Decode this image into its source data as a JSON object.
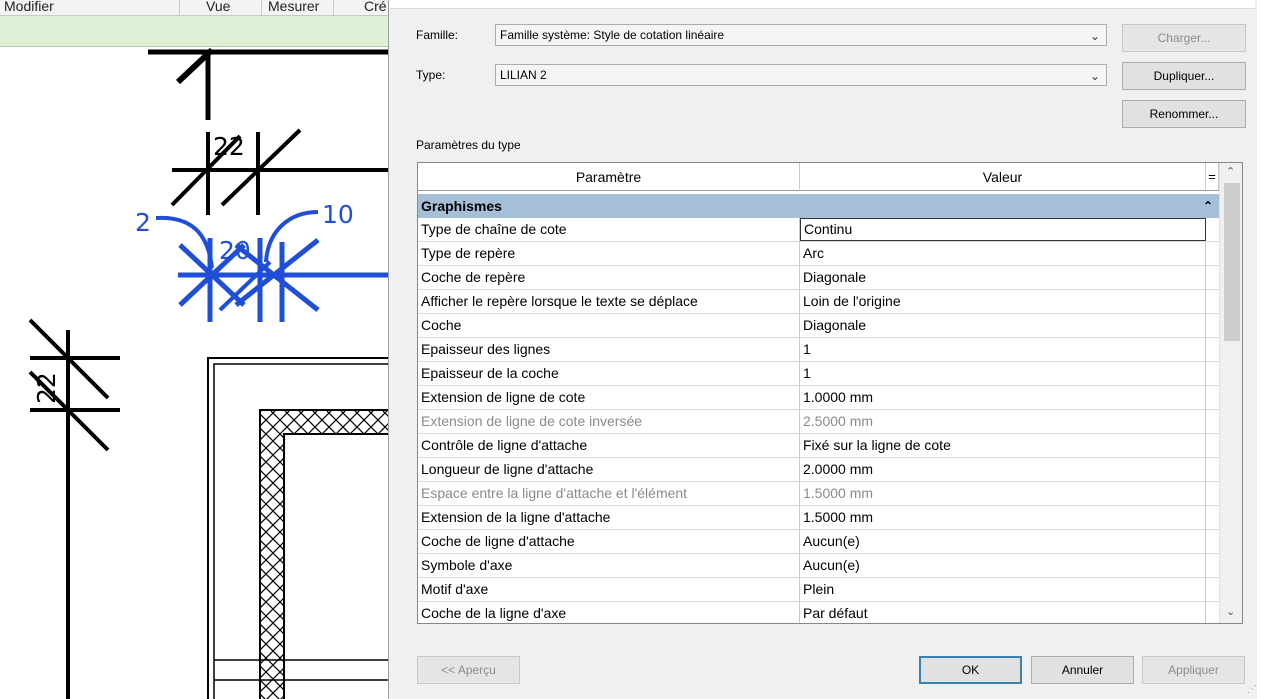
{
  "ribbon": {
    "tabs": [
      "Modifier",
      "Vue",
      "Mesurer",
      "Cré"
    ]
  },
  "drawing": {
    "dims": {
      "a": "22",
      "b": "2",
      "c": "20",
      "d": "10",
      "e": "22"
    },
    "colors": {
      "black": "#000000",
      "selected": "#1f4fd6"
    }
  },
  "dialog": {
    "famille_label": "Famille:",
    "famille_value": "Famille système: Style de cotation linéaire",
    "type_label": "Type:",
    "type_value": "LILIAN 2",
    "buttons": {
      "charger": "Charger...",
      "dupliquer": "Dupliquer...",
      "renommer": "Renommer..."
    },
    "params_title": "Paramètres du type",
    "grid": {
      "col_param": "Paramètre",
      "col_value": "Valeur",
      "col_eq": "=",
      "group": "Graphismes",
      "group_toggle": "⌃",
      "rows": [
        {
          "param": "Type de chaîne de cote",
          "value": "Continu"
        },
        {
          "param": "Type de repère",
          "value": "Arc"
        },
        {
          "param": "Coche de repère",
          "value": "Diagonale"
        },
        {
          "param": "Afficher le repère lorsque le texte se déplace",
          "value": "Loin de l'origine"
        },
        {
          "param": "Coche",
          "value": "Diagonale"
        },
        {
          "param": "Epaisseur des lignes",
          "value": "1"
        },
        {
          "param": "Epaisseur de la coche",
          "value": "1"
        },
        {
          "param": "Extension de ligne de cote",
          "value": "1.0000 mm"
        },
        {
          "param": "Extension de ligne de cote inversée",
          "value": "2.5000 mm"
        },
        {
          "param": "Contrôle de ligne d'attache",
          "value": "Fixé sur la ligne de cote"
        },
        {
          "param": "Longueur de ligne d'attache",
          "value": "2.0000 mm"
        },
        {
          "param": "Espace entre la ligne d'attache et l'élément",
          "value": "1.5000 mm"
        },
        {
          "param": "Extension de la ligne d'attache",
          "value": "1.5000 mm"
        },
        {
          "param": "Coche de ligne d'attache",
          "value": "Aucun(e)"
        },
        {
          "param": "Symbole d'axe",
          "value": "Aucun(e)"
        },
        {
          "param": "Motif d'axe",
          "value": "Plein"
        },
        {
          "param": "Coche de la ligne d'axe",
          "value": "Par défaut"
        }
      ]
    },
    "footer": {
      "apercu": "<< Aperçu",
      "ok": "OK",
      "annuler": "Annuler",
      "appliquer": "Appliquer"
    }
  }
}
